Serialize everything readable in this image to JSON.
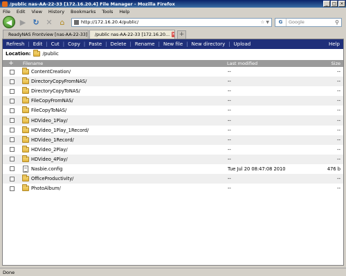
{
  "window": {
    "title": "/public nas-AA-22-33 [172.16.20.4] File Manager - Mozilla Firefox",
    "min": "_",
    "max": "□",
    "close": "×"
  },
  "menu": [
    "File",
    "Edit",
    "View",
    "History",
    "Bookmarks",
    "Tools",
    "Help"
  ],
  "nav": {
    "url": "http://172.16.20.4/public/",
    "search_engine": "G",
    "search_placeholder": "Google"
  },
  "tabs": [
    {
      "label": "ReadyNAS Frontview [nas-AA-22-33]",
      "active": false
    },
    {
      "label": "/public nas-AA-22-33 [172.16.20...",
      "active": true
    }
  ],
  "new_tab_label": "+",
  "toolbar": {
    "items": [
      "Refresh",
      "Edit",
      "Cut",
      "Copy",
      "Paste",
      "Delete",
      "Rename",
      "New file",
      "New directory",
      "Upload"
    ],
    "help": "Help"
  },
  "location": {
    "label": "Location:",
    "path": "/public"
  },
  "columns": {
    "add": "+",
    "filename": "Filename",
    "modified": "Last modified",
    "size": "Size"
  },
  "files": [
    {
      "name": "ContentCreation/",
      "type": "folder",
      "modified": "--",
      "size": "--"
    },
    {
      "name": "DirectoryCopyFromNAS/",
      "type": "folder",
      "modified": "--",
      "size": "--"
    },
    {
      "name": "DirectoryCopyToNAS/",
      "type": "folder",
      "modified": "--",
      "size": "--"
    },
    {
      "name": "FileCopyFromNAS/",
      "type": "folder",
      "modified": "--",
      "size": "--"
    },
    {
      "name": "FileCopyToNAS/",
      "type": "folder",
      "modified": "--",
      "size": "--"
    },
    {
      "name": "HDVideo_1Play/",
      "type": "folder",
      "modified": "--",
      "size": "--"
    },
    {
      "name": "HDVideo_1Play_1Record/",
      "type": "folder",
      "modified": "--",
      "size": "--"
    },
    {
      "name": "HDVideo_1Record/",
      "type": "folder",
      "modified": "--",
      "size": "--"
    },
    {
      "name": "HDVideo_2Play/",
      "type": "folder",
      "modified": "--",
      "size": "--"
    },
    {
      "name": "HDVideo_4Play/",
      "type": "folder",
      "modified": "--",
      "size": "--"
    },
    {
      "name": "Nasbie.config",
      "type": "file",
      "modified": "Tue Jul 20 08:47:08 2010",
      "size": "476 b"
    },
    {
      "name": "OfficeProductivity/",
      "type": "folder",
      "modified": "--",
      "size": "--"
    },
    {
      "name": "PhotoAlbum/",
      "type": "folder",
      "modified": "--",
      "size": "--"
    }
  ],
  "status": "Done",
  "colors": {
    "toolbar_bg": "#1f2f7a",
    "header_bg": "#9a9a9a",
    "alt_row": "#efefef",
    "folder": "#e2b43a"
  }
}
